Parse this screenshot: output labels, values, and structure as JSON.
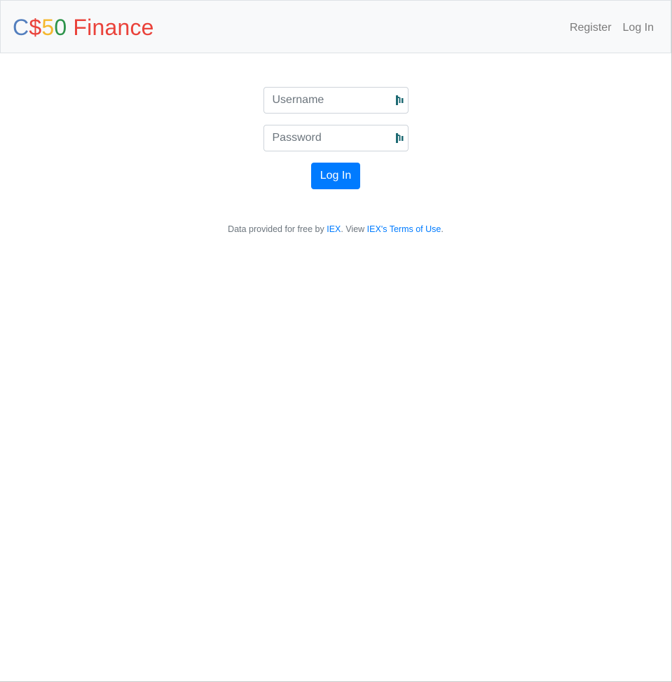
{
  "brand": {
    "parts": [
      {
        "text": "C",
        "color": "#537fbe"
      },
      {
        "text": "$",
        "color": "#ea433b"
      },
      {
        "text": "5",
        "color": "#f5b82e"
      },
      {
        "text": "0",
        "color": "#2e944b"
      },
      {
        "text": " Finance",
        "color": "#ea433b"
      }
    ]
  },
  "nav": {
    "register": "Register",
    "login": "Log In"
  },
  "form": {
    "username_placeholder": "Username",
    "password_placeholder": "Password",
    "submit_label": "Log In"
  },
  "footer": {
    "text_before": "Data provided for free by ",
    "iex_link": "IEX",
    "text_middle": ". View ",
    "terms_link": "IEX's Terms of Use",
    "text_after": "."
  },
  "colors": {
    "primary": "#007bff",
    "navbar_bg": "#f8f9fa",
    "field_icon": "#1e6a73"
  },
  "icons": {
    "field_icon": "password-manager-icon"
  }
}
